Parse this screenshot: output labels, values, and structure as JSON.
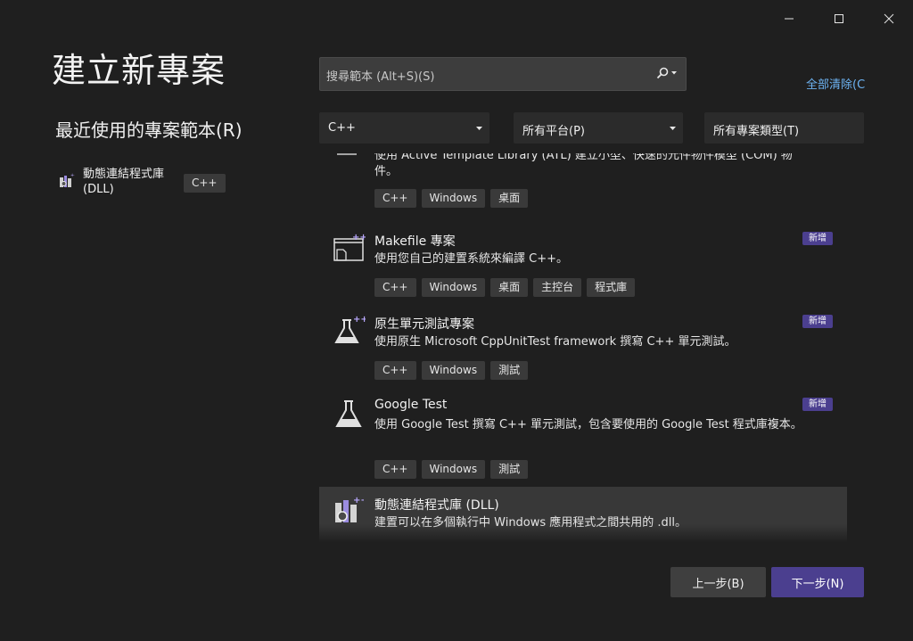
{
  "window": {
    "controls": [
      "minimize-icon",
      "maximize-icon",
      "close-icon"
    ]
  },
  "page": {
    "title": "建立新專案"
  },
  "recent": {
    "title": "最近使用的專案範本(R)",
    "items": [
      {
        "name": "動態連結程式庫 (DLL)",
        "tag": "C++",
        "icon": "dll-icon"
      }
    ]
  },
  "search": {
    "placeholder": "搜尋範本 (Alt+S)(S)",
    "icon": "search-icon"
  },
  "filters": {
    "clear_all": "全部清除(C",
    "language": "C++",
    "platform": "所有平台(P)",
    "project_type": "所有專案類型(T)"
  },
  "templates": [
    {
      "name": "",
      "description": "使用 Active Template Library (ATL) 建立小型、快速的元件物件模型 (COM) 物件。",
      "tags": [
        "C++",
        "Windows",
        "桌面"
      ],
      "is_new": false,
      "icon": "atl-icon"
    },
    {
      "name": "Makefile 專案",
      "description": "使用您自己的建置系統來編譯 C++。",
      "tags": [
        "C++",
        "Windows",
        "桌面",
        "主控台",
        "程式庫"
      ],
      "is_new": true,
      "new_label": "新增",
      "icon": "makefile-icon"
    },
    {
      "name": "原生單元測試專案",
      "description": "使用原生 Microsoft CppUnitTest framework 撰寫 C++ 單元測試。",
      "tags": [
        "C++",
        "Windows",
        "測試"
      ],
      "is_new": true,
      "new_label": "新增",
      "icon": "flask-plus-icon"
    },
    {
      "name": "Google Test",
      "description": "使用 Google Test 撰寫 C++ 單元測試，包含要使用的 Google Test 程式庫複本。",
      "tags": [
        "C++",
        "Windows",
        "測試"
      ],
      "is_new": true,
      "new_label": "新增",
      "icon": "flask-icon"
    },
    {
      "name": "動態連結程式庫 (DLL)",
      "description": "建置可以在多個執行中 Windows 應用程式之間共用的 .dll。",
      "tags": [],
      "is_new": false,
      "selected": true,
      "icon": "dll-icon"
    }
  ],
  "footer": {
    "back": "上一步(B)",
    "next": "下一步(N)"
  },
  "colors": {
    "background": "#1f1f1f",
    "accent": "#4b3f8f",
    "link": "#6db3f2",
    "tag_bg": "#3a3a3a"
  }
}
